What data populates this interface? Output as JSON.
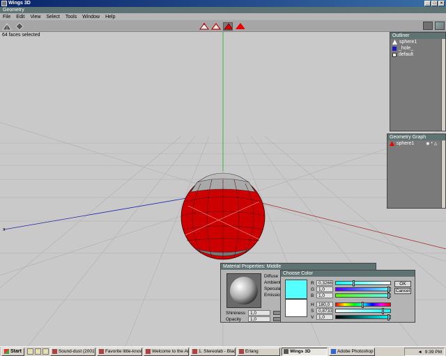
{
  "window": {
    "title": "Wings 3D"
  },
  "geometry_header": "Geometry",
  "menu": [
    "File",
    "Edit",
    "View",
    "Select",
    "Tools",
    "Window",
    "Help"
  ],
  "status": "64 faces selected",
  "axis_label_x": "x",
  "outliner": {
    "title": "Outliner",
    "items": [
      {
        "label": "sphere1",
        "icon": "triangle-icon"
      },
      {
        "label": "_hole_",
        "icon": "blue-square-icon"
      },
      {
        "label": "default",
        "icon": "material-icon"
      }
    ]
  },
  "geometry_graph": {
    "title": "Geometry Graph",
    "items": [
      {
        "label": "sphere1"
      }
    ]
  },
  "material_dialog": {
    "title": "Material Properties: Middle",
    "properties": [
      "Diffuse",
      "Ambient",
      "Specular",
      "Emission"
    ],
    "shininess_label": "Shininess",
    "shininess_value": "1,0",
    "opacity_label": "Opacity",
    "opacity_value": "1,0"
  },
  "color_dialog": {
    "title": "Choose Color",
    "r_label": "R",
    "r_value": "0,3266",
    "r_level": 0.33,
    "g_label": "G",
    "g_value": "1,0",
    "g_level": 1.0,
    "b_label": "B",
    "b_value": "1,0",
    "b_level": 1.0,
    "h_label": "H",
    "h_value": "180,0",
    "h_level": 0.5,
    "s_label": "S",
    "s_value": "0,8733",
    "s_level": 0.87,
    "v_label": "V",
    "v_value": "1,0",
    "v_level": 1.0,
    "ok_label": "OK",
    "cancel_label": "Cancel",
    "new_color": "#55ffff",
    "old_color": "#ffffff"
  },
  "taskbar": {
    "start_label": "Start",
    "tasks": [
      "Sound-dust (2001)",
      "Favorite little-know...",
      "Welcome to the Art ...",
      "1. Stereolab - Black ...",
      "Erlang",
      "Wings 3D",
      "Adobe Photoshop"
    ],
    "active_task": "Wings 3D",
    "clock": "9:39 PM"
  },
  "colors": {
    "sphere_red": "#cc0000",
    "accent": "#5f7372",
    "viewport_bg": "#c9c9c9"
  }
}
